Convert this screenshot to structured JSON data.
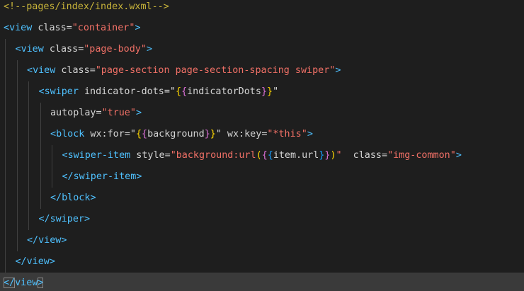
{
  "editor": {
    "colors": {
      "background": "#1e1e1e",
      "current_line": "#3a3a3a",
      "tag": "#4fc1ff",
      "attribute": "#d4d4d4",
      "string": "#f07066",
      "comment": "#c8b43a",
      "bracket_gold": "#ffd700",
      "bracket_purple": "#da70d6",
      "bracket_blue": "#179fff",
      "indent_guide": "#404040"
    },
    "lines": [
      {
        "indent": 0,
        "current": false,
        "tokens": [
          {
            "t": "<!--pages/index/index.wxml-->",
            "c": "comment"
          }
        ]
      },
      {
        "indent": 0,
        "current": false,
        "tokens": [
          {
            "t": "<",
            "c": "tag"
          },
          {
            "t": "view",
            "c": "tag"
          },
          {
            "t": " class",
            "c": "attr"
          },
          {
            "t": "=",
            "c": "punc"
          },
          {
            "t": "\"container\"",
            "c": "str"
          },
          {
            "t": ">",
            "c": "tag"
          }
        ]
      },
      {
        "indent": 1,
        "current": false,
        "tokens": [
          {
            "t": "<",
            "c": "tag"
          },
          {
            "t": "view",
            "c": "tag"
          },
          {
            "t": " class",
            "c": "attr"
          },
          {
            "t": "=",
            "c": "punc"
          },
          {
            "t": "\"page-body\"",
            "c": "str"
          },
          {
            "t": ">",
            "c": "tag"
          }
        ]
      },
      {
        "indent": 2,
        "current": false,
        "tokens": [
          {
            "t": "<",
            "c": "tag"
          },
          {
            "t": "view",
            "c": "tag"
          },
          {
            "t": " class",
            "c": "attr"
          },
          {
            "t": "=",
            "c": "punc"
          },
          {
            "t": "\"page-section page-section-spacing swiper\"",
            "c": "str"
          },
          {
            "t": ">",
            "c": "tag"
          }
        ]
      },
      {
        "indent": 3,
        "current": false,
        "tokens": [
          {
            "t": "<",
            "c": "tag"
          },
          {
            "t": "swiper",
            "c": "tag"
          },
          {
            "t": " indicator-dots",
            "c": "attr"
          },
          {
            "t": "=",
            "c": "punc"
          },
          {
            "t": "\"",
            "c": "punc"
          },
          {
            "t": "{",
            "c": "b1"
          },
          {
            "t": "{",
            "c": "b2"
          },
          {
            "t": "indicatorDots",
            "c": "expr"
          },
          {
            "t": "}",
            "c": "b2"
          },
          {
            "t": "}",
            "c": "b1"
          },
          {
            "t": "\"",
            "c": "punc"
          }
        ]
      },
      {
        "indent": 4,
        "current": false,
        "tokens": [
          {
            "t": "autoplay",
            "c": "attr"
          },
          {
            "t": "=",
            "c": "punc"
          },
          {
            "t": "\"true\"",
            "c": "str"
          },
          {
            "t": ">",
            "c": "tag"
          }
        ]
      },
      {
        "indent": 4,
        "current": false,
        "tokens": [
          {
            "t": "<",
            "c": "tag"
          },
          {
            "t": "block",
            "c": "tag"
          },
          {
            "t": " wx:for",
            "c": "attr"
          },
          {
            "t": "=",
            "c": "punc"
          },
          {
            "t": "\"",
            "c": "punc"
          },
          {
            "t": "{",
            "c": "b1"
          },
          {
            "t": "{",
            "c": "b2"
          },
          {
            "t": "background",
            "c": "expr"
          },
          {
            "t": "}",
            "c": "b2"
          },
          {
            "t": "}",
            "c": "b1"
          },
          {
            "t": "\"",
            "c": "punc"
          },
          {
            "t": " wx:key",
            "c": "attr"
          },
          {
            "t": "=",
            "c": "punc"
          },
          {
            "t": "\"*this\"",
            "c": "str"
          },
          {
            "t": ">",
            "c": "tag"
          }
        ]
      },
      {
        "indent": 5,
        "current": false,
        "tokens": [
          {
            "t": "<",
            "c": "tag"
          },
          {
            "t": "swiper-item",
            "c": "tag"
          },
          {
            "t": " style",
            "c": "attr"
          },
          {
            "t": "=",
            "c": "punc"
          },
          {
            "t": "\"background:url",
            "c": "str"
          },
          {
            "t": "(",
            "c": "b1"
          },
          {
            "t": "{",
            "c": "b2"
          },
          {
            "t": "{",
            "c": "b3"
          },
          {
            "t": "item.url",
            "c": "expr"
          },
          {
            "t": "}",
            "c": "b3"
          },
          {
            "t": "}",
            "c": "b2"
          },
          {
            "t": ")",
            "c": "b1"
          },
          {
            "t": "\"",
            "c": "str"
          },
          {
            "t": "  class",
            "c": "attr"
          },
          {
            "t": "=",
            "c": "punc"
          },
          {
            "t": "\"img-common\"",
            "c": "str"
          },
          {
            "t": ">",
            "c": "tag"
          }
        ]
      },
      {
        "indent": 5,
        "current": false,
        "tokens": [
          {
            "t": "</",
            "c": "tag"
          },
          {
            "t": "swiper-item",
            "c": "tag"
          },
          {
            "t": ">",
            "c": "tag"
          }
        ]
      },
      {
        "indent": 4,
        "current": false,
        "tokens": [
          {
            "t": "</",
            "c": "tag"
          },
          {
            "t": "block",
            "c": "tag"
          },
          {
            "t": ">",
            "c": "tag"
          }
        ]
      },
      {
        "indent": 3,
        "current": false,
        "tokens": [
          {
            "t": "</",
            "c": "tag"
          },
          {
            "t": "swiper",
            "c": "tag"
          },
          {
            "t": ">",
            "c": "tag"
          }
        ]
      },
      {
        "indent": 2,
        "current": false,
        "tokens": [
          {
            "t": "</",
            "c": "tag"
          },
          {
            "t": "view",
            "c": "tag"
          },
          {
            "t": ">",
            "c": "tag"
          }
        ]
      },
      {
        "indent": 1,
        "current": false,
        "tokens": [
          {
            "t": "</",
            "c": "tag"
          },
          {
            "t": "view",
            "c": "tag"
          },
          {
            "t": ">",
            "c": "tag"
          }
        ]
      },
      {
        "indent": 0,
        "current": true,
        "tokens": [
          {
            "t": "</",
            "c": "tag",
            "match": true
          },
          {
            "t": "view",
            "c": "tag"
          },
          {
            "t": ">",
            "c": "tag",
            "match": true
          }
        ]
      }
    ]
  }
}
